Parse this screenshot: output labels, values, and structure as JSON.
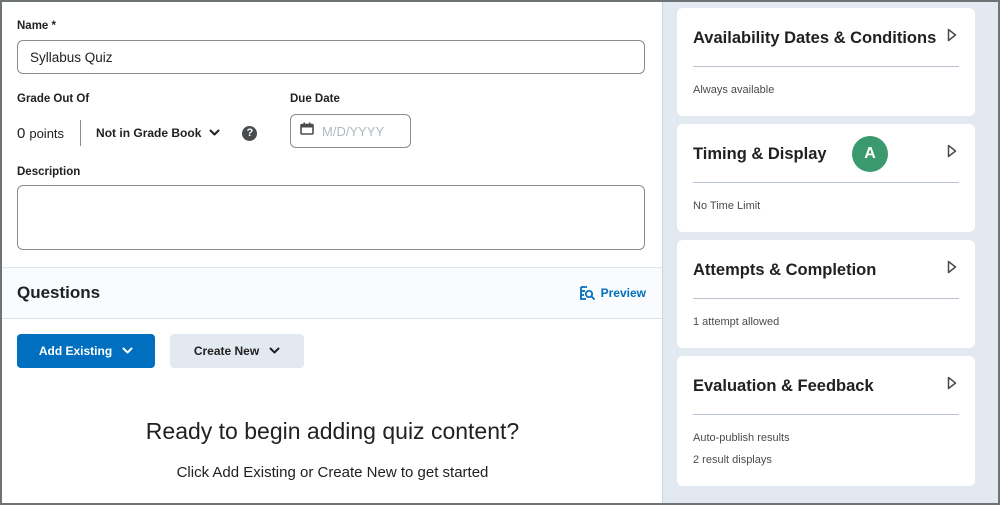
{
  "form": {
    "name_label": "Name *",
    "name_value": "Syllabus Quiz",
    "grade_label": "Grade Out Of",
    "points_value": "0",
    "points_unit": "points",
    "gradebook_option": "Not in Grade Book",
    "help_icon": "?",
    "due_date_label": "Due Date",
    "due_date_placeholder": "M/D/YYYY",
    "description_label": "Description",
    "description_value": ""
  },
  "questions": {
    "title": "Questions",
    "preview_label": "Preview",
    "add_existing_label": "Add Existing",
    "create_new_label": "Create New",
    "empty_title": "Ready to begin adding quiz content?",
    "empty_subtitle": "Click Add Existing or Create New to get started"
  },
  "sidebar": {
    "cards": [
      {
        "title": "Availability Dates & Conditions",
        "lines": [
          "Always available"
        ]
      },
      {
        "title": "Timing & Display",
        "lines": [
          "No Time Limit"
        ],
        "avatar": "A"
      },
      {
        "title": "Attempts & Completion",
        "lines": [
          "1 attempt allowed"
        ]
      },
      {
        "title": "Evaluation & Feedback",
        "lines": [
          "Auto-publish results",
          "2 result displays"
        ]
      }
    ]
  },
  "colors": {
    "primary": "#006fbf",
    "secondary_bg": "#e3e9f1",
    "avatar_bg": "#3a9a6d"
  }
}
